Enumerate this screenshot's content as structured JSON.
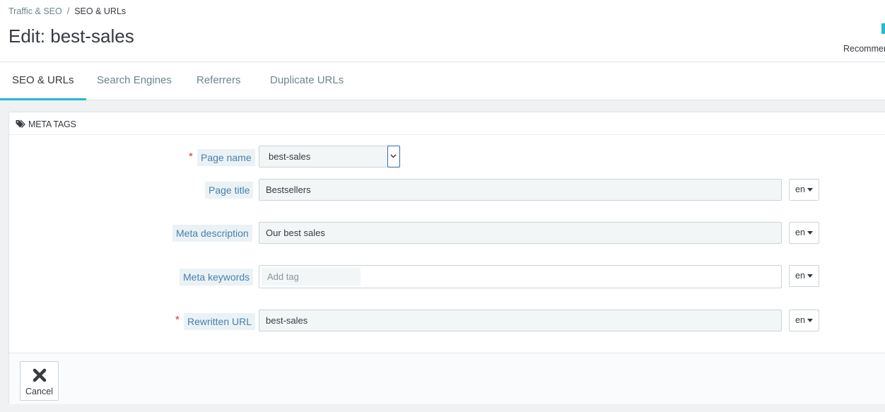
{
  "breadcrumb": {
    "parent": "Traffic & SEO",
    "separator": "/",
    "current": "SEO & URLs"
  },
  "page_title": "Edit: best-sales",
  "toolbar": {
    "recommend_label": "Recommer"
  },
  "tabs": [
    {
      "label": "SEO & URLs",
      "active": true
    },
    {
      "label": "Search Engines",
      "active": false
    },
    {
      "label": "Referrers",
      "active": false
    },
    {
      "label": "Duplicate URLs",
      "active": false
    }
  ],
  "panel": {
    "heading": "META TAGS",
    "icon": "tags-icon",
    "fields": {
      "page_name": {
        "label": "Page name",
        "required": "*",
        "value": "best-sales"
      },
      "page_title": {
        "label": "Page title",
        "value": "Bestsellers",
        "lang": "en"
      },
      "meta_description": {
        "label": "Meta description",
        "value": "Our best sales",
        "lang": "en"
      },
      "meta_keywords": {
        "label": "Meta keywords",
        "placeholder": "Add tag",
        "lang": "en"
      },
      "rewritten_url": {
        "label": "Rewritten URL",
        "required": "*",
        "value": "best-sales",
        "lang": "en"
      }
    },
    "footer": {
      "cancel_label": "Cancel",
      "cancel_icon": "close-icon"
    }
  },
  "colors": {
    "accent": "#25b9d7",
    "required": "#e0342e",
    "label_text": "#4a7fa8"
  }
}
